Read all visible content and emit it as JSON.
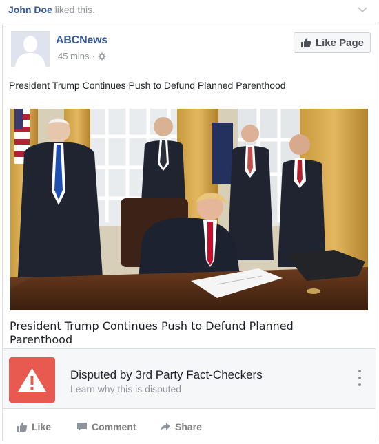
{
  "liked_bar": {
    "name": "John Doe",
    "text": " liked this."
  },
  "post": {
    "page_name": "ABCNews",
    "time": "45 mins",
    "separator": "·",
    "like_page_label": "Like Page",
    "text": "President Trump Continues Push to Defund Planned Parenthood",
    "link_title": "President Trump Continues Push to Defund Planned Parenthood"
  },
  "dispute": {
    "title": "Disputed by 3rd Party Fact-Checkers",
    "subtitle": "Learn why this is disputed"
  },
  "actions": {
    "like": "Like",
    "comment": "Comment",
    "share": "Share"
  },
  "colors": {
    "link": "#365899",
    "warning": "#e85a4f",
    "muted": "#90949c"
  }
}
